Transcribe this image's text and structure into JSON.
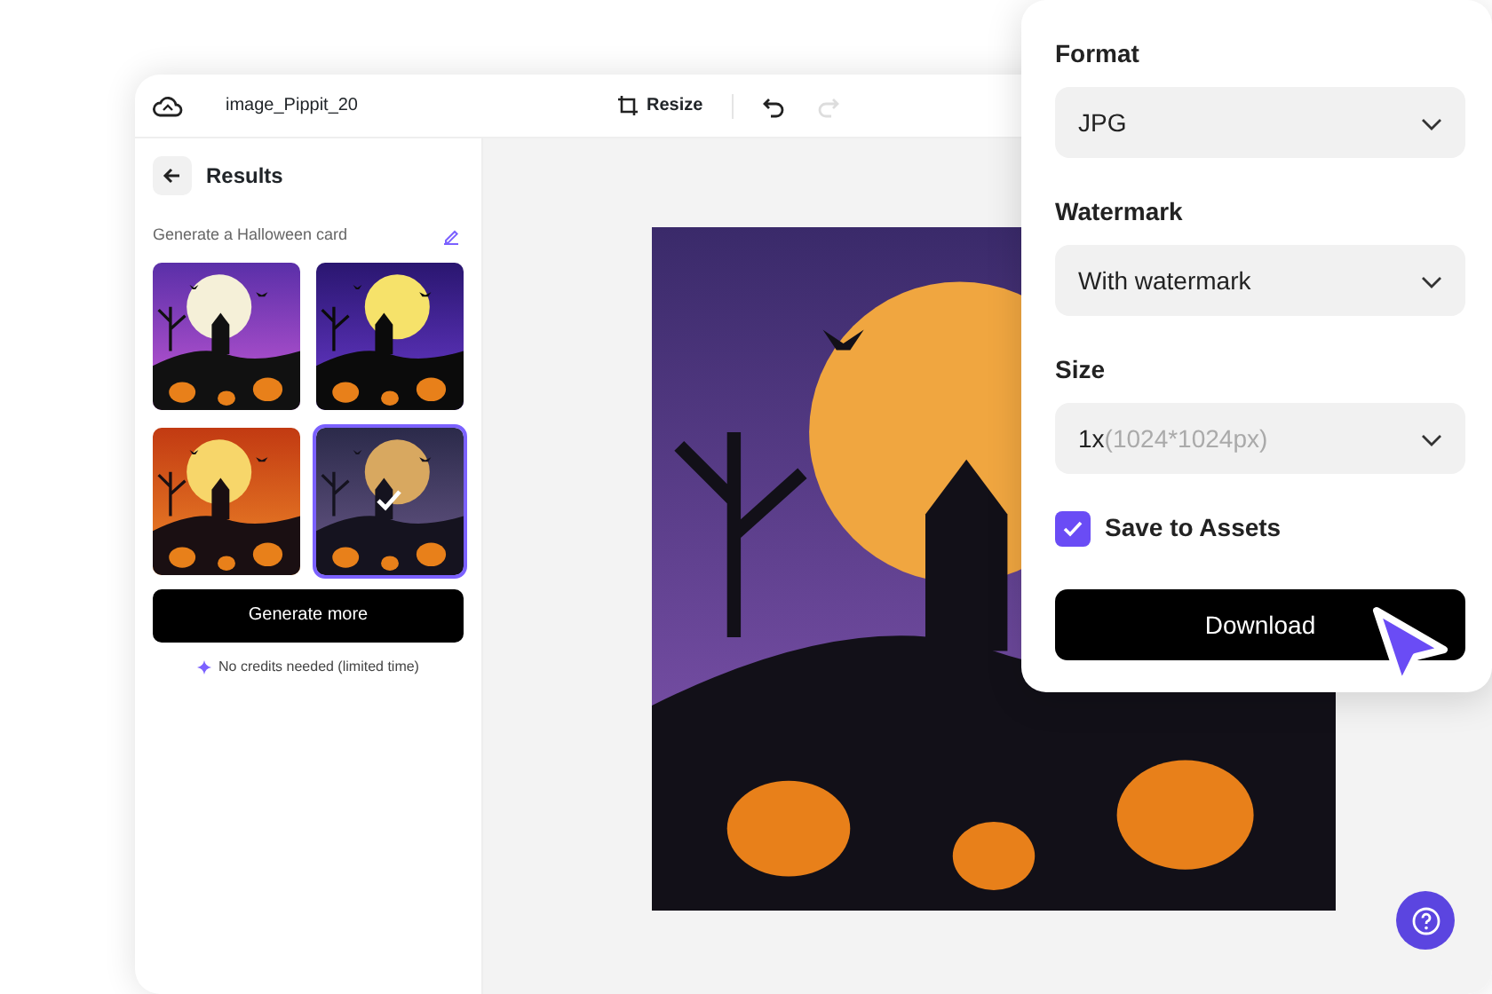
{
  "header": {
    "file_name": "image_Pippit_20",
    "resize_button": "Resize",
    "history": [
      {
        "kind": "undo",
        "disabled": false
      },
      {
        "kind": "redo",
        "disabled": true
      }
    ]
  },
  "sidebar": {
    "title": "Results",
    "prompt": "Generate a Halloween card",
    "results": [
      {
        "kind": "picture",
        "selected": false
      },
      {
        "kind": "picture",
        "selected": false
      },
      {
        "kind": "picture",
        "selected": false
      },
      {
        "kind": "picture",
        "selected": true
      }
    ],
    "generate_button": "Generate more",
    "note": "No credits needed (limited time)"
  },
  "export_panel": {
    "fields": [
      {
        "label": "Format",
        "value": "JPG"
      },
      {
        "label": "Watermark",
        "value": "With watermark"
      },
      {
        "label": "Size",
        "value": "1x",
        "hint": "(1024*1024px)"
      }
    ],
    "save_to_assets": {
      "label": "Save to Assets",
      "checked": true
    },
    "download_button": "Download"
  }
}
